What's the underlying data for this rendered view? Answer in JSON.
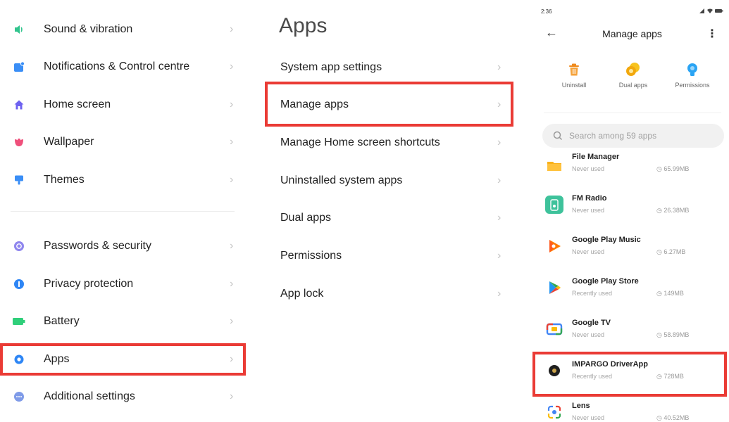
{
  "settings": {
    "items": [
      {
        "label": "Sound & vibration",
        "icon": "speaker-icon"
      },
      {
        "label": "Notifications & Control centre",
        "icon": "notification-icon"
      },
      {
        "label": "Home screen",
        "icon": "home-icon"
      },
      {
        "label": "Wallpaper",
        "icon": "wallpaper-icon"
      },
      {
        "label": "Themes",
        "icon": "themes-icon"
      },
      {
        "label": "Passwords & security",
        "icon": "lock-icon"
      },
      {
        "label": "Privacy protection",
        "icon": "privacy-icon"
      },
      {
        "label": "Battery",
        "icon": "battery-icon"
      },
      {
        "label": "Apps",
        "icon": "gear-icon"
      },
      {
        "label": "Additional settings",
        "icon": "more-icon"
      }
    ],
    "highlighted": "Apps"
  },
  "apps_menu": {
    "title": "Apps",
    "items": [
      {
        "label": "System app settings"
      },
      {
        "label": "Manage apps"
      },
      {
        "label": "Manage Home screen shortcuts"
      },
      {
        "label": "Uninstalled system apps"
      },
      {
        "label": "Dual apps"
      },
      {
        "label": "Permissions"
      },
      {
        "label": "App lock"
      }
    ],
    "highlighted": "Manage apps"
  },
  "manage_apps": {
    "status_time": "2:36",
    "title": "Manage apps",
    "quick_actions": [
      {
        "label": "Uninstall",
        "icon": "trash-icon"
      },
      {
        "label": "Dual apps",
        "icon": "dual-apps-icon"
      },
      {
        "label": "Permissions",
        "icon": "permissions-icon"
      }
    ],
    "search_placeholder": "Search among 59 apps",
    "apps": [
      {
        "name": "File Manager",
        "usage": "Never used",
        "size": "65.99MB",
        "icon": "folder-icon"
      },
      {
        "name": "FM Radio",
        "usage": "Never used",
        "size": "26.38MB",
        "icon": "radio-icon"
      },
      {
        "name": "Google Play Music",
        "usage": "Never used",
        "size": "6.27MB",
        "icon": "play-music-icon"
      },
      {
        "name": "Google Play Store",
        "usage": "Recently used",
        "size": "149MB",
        "icon": "play-store-icon"
      },
      {
        "name": "Google TV",
        "usage": "Never used",
        "size": "58.89MB",
        "icon": "google-tv-icon"
      },
      {
        "name": "IMPARGO DriverApp",
        "usage": "Recently used",
        "size": "728MB",
        "icon": "impargo-icon"
      },
      {
        "name": "Lens",
        "usage": "Never used",
        "size": "40.52MB",
        "icon": "lens-icon"
      }
    ],
    "highlighted": "IMPARGO DriverApp"
  },
  "colors": {
    "highlight": "#ea3b35"
  }
}
